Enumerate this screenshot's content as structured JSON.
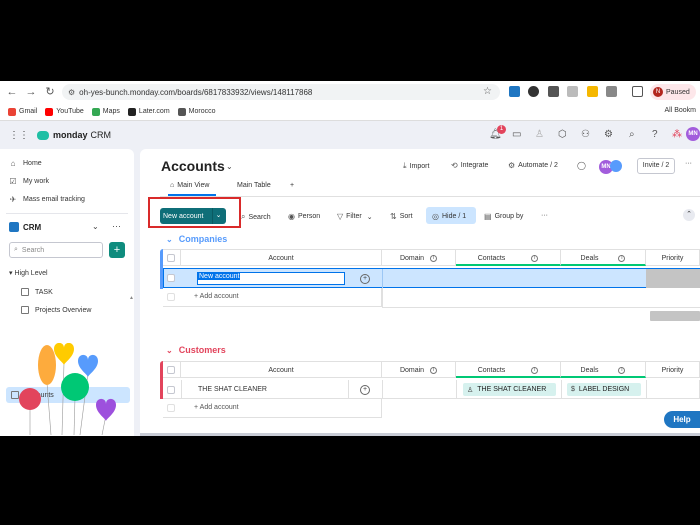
{
  "browser": {
    "url": "oh-yes-bunch.monday.com/boards/6817833932/views/148117868",
    "profile_initial": "N",
    "profile_status": "Paused",
    "bookmarks": [
      {
        "label": "Gmail",
        "color": "#ea4335"
      },
      {
        "label": "YouTube",
        "color": "#ff0000"
      },
      {
        "label": "Maps",
        "color": "#34a853"
      },
      {
        "label": "Later.com",
        "color": "#222222"
      },
      {
        "label": "Morocco",
        "color": "#555555"
      }
    ],
    "all_bookmarks": "All Bookm"
  },
  "app": {
    "logo_bold": "monday",
    "logo_rest": "CRM",
    "notification_count": "1",
    "user_initials": "MN"
  },
  "sidebar": {
    "home": "Home",
    "my_work": "My work",
    "mass_email": "Mass email tracking",
    "workspace": "CRM",
    "search_placeholder": "Search",
    "folder": "▾ High Level",
    "items": [
      "TASK",
      "Projects Overview",
      "Accounts"
    ]
  },
  "board": {
    "title": "Accounts",
    "tabs": [
      "Main View",
      "Main Table",
      "+"
    ],
    "import": "Import",
    "integrate": "Integrate",
    "automate": "Automate / 2",
    "invite": "Invite / 2",
    "new_button": "New account",
    "toolbar": {
      "search": "Search",
      "person": "Person",
      "filter": "Filter",
      "sort": "Sort",
      "hide": "Hide / 1",
      "group_by": "Group by",
      "more": "···"
    }
  },
  "groups": [
    {
      "name": "Companies",
      "color": "#579bfc",
      "columns": [
        "Account",
        "Domain",
        "Contacts",
        "Deals",
        "Priority"
      ],
      "rows": [
        {
          "account": "New account",
          "editing": true
        }
      ],
      "add_label": "+ Add account"
    },
    {
      "name": "Customers",
      "color": "#e2445c",
      "columns": [
        "Account",
        "Domain",
        "Contacts",
        "Deals",
        "Priority"
      ],
      "rows": [
        {
          "account": "THE SHAT CLEANER",
          "contact": "THE SHAT CLEANER",
          "deal": "LABEL DESIGN"
        }
      ],
      "add_label": "+ Add account"
    }
  ],
  "help_label": "Help"
}
